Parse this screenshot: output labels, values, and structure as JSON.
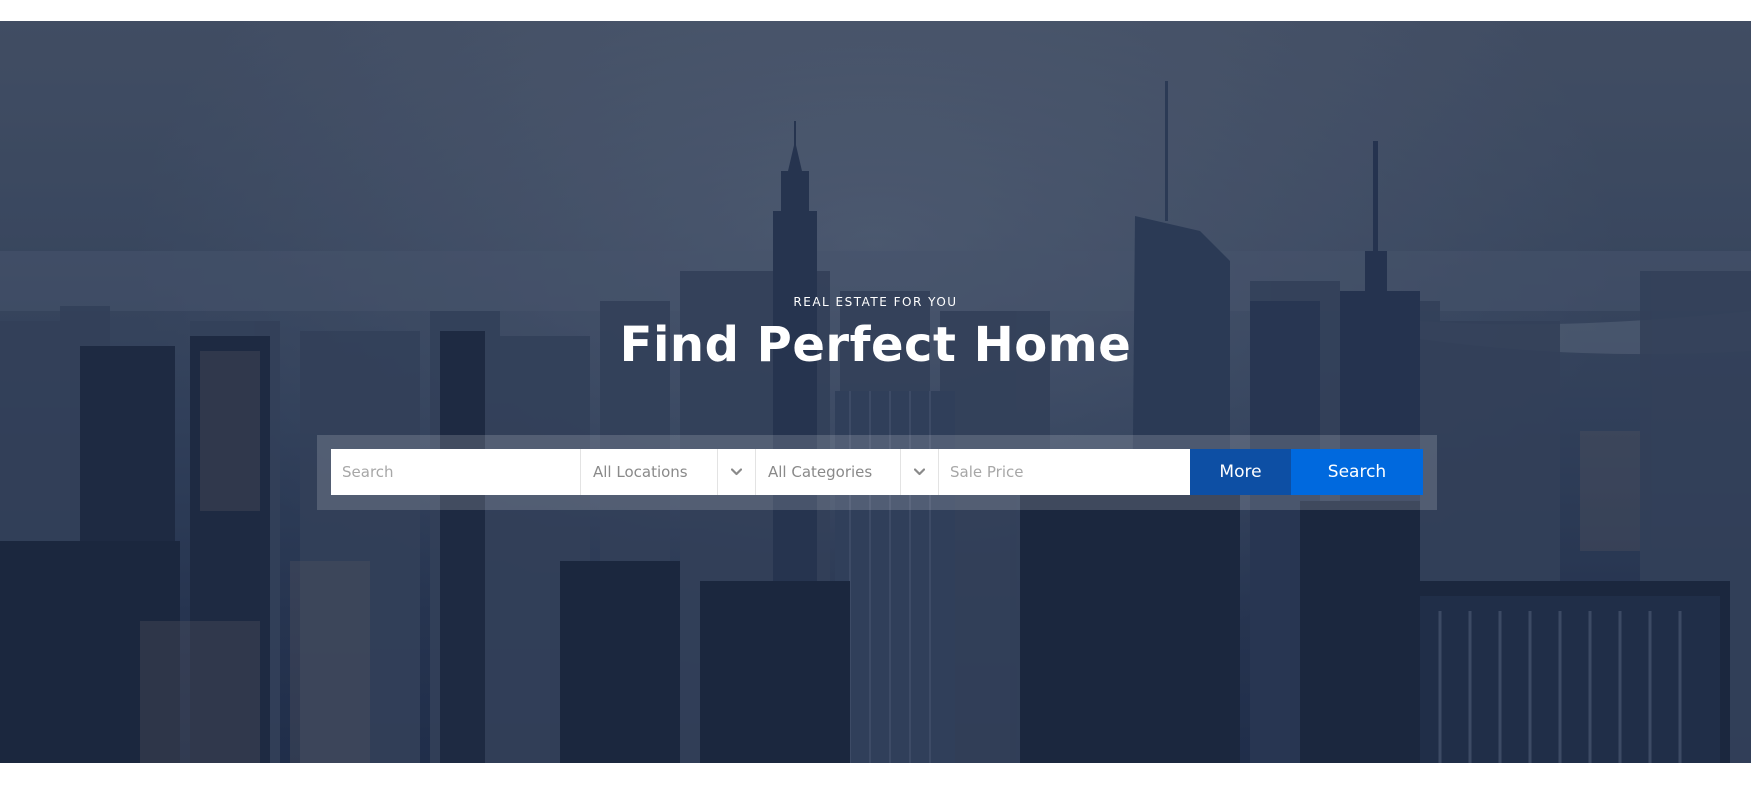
{
  "hero": {
    "kicker": "REAL ESTATE FOR YOU",
    "title": "Find Perfect Home",
    "background": "city-skyline-photo"
  },
  "search_form": {
    "search": {
      "placeholder": "Search"
    },
    "location": {
      "value": "All Locations",
      "icon": "chevron-down-icon"
    },
    "category": {
      "value": "All Categories",
      "icon": "chevron-down-icon"
    },
    "price": {
      "placeholder": "Sale Price"
    },
    "more_label": "More",
    "search_label": "Search"
  },
  "colors": {
    "more_button": "#0d4fa4",
    "search_button": "#0069de",
    "overlay": "#1c2c4c"
  }
}
